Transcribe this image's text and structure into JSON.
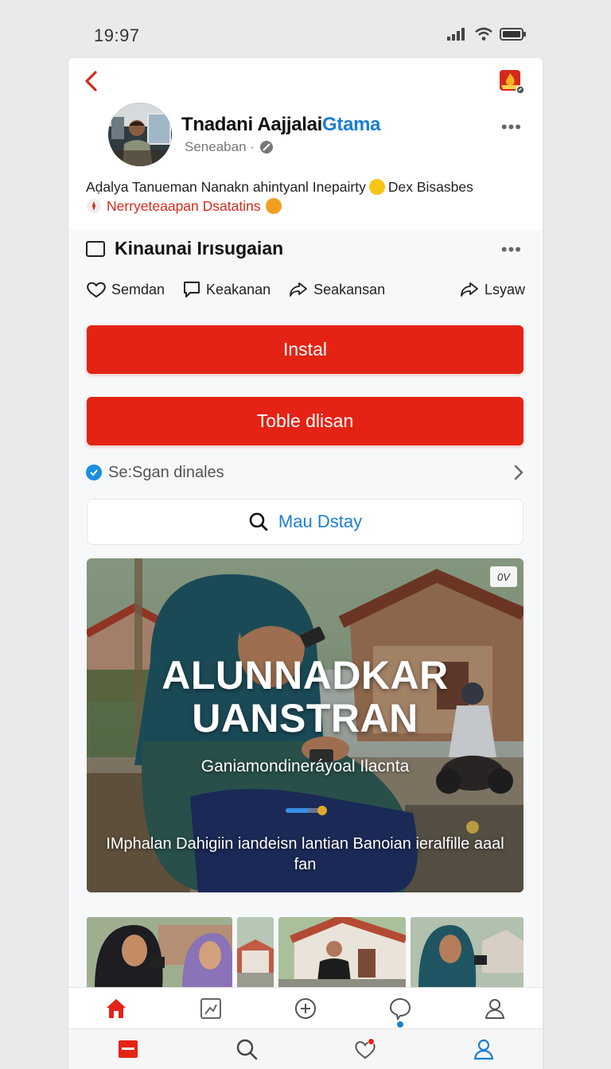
{
  "status": {
    "time": "19:97"
  },
  "profile": {
    "name_part1": "Tnadani Aajjalai",
    "name_part2": "Gtama",
    "subtitle": "Seneaban ·"
  },
  "post": {
    "line1": "Aḍalya Tanueman Nanakn ahintyanl Inepairty",
    "line1_tail": "Dex Bisasbes",
    "line2": "Nerryeteaapan Dsatatins"
  },
  "section": {
    "title": "Kinaunai Irısugaian",
    "actions": [
      {
        "label": "Semdan",
        "icon": "heart-icon"
      },
      {
        "label": "Keakanan",
        "icon": "comment-icon"
      },
      {
        "label": "Seakansan",
        "icon": "share-icon"
      },
      {
        "label": "Lsyaw",
        "icon": "share-icon"
      }
    ]
  },
  "buttons": {
    "install": "Instal",
    "toble": "Toble dlisan"
  },
  "link_row": {
    "label": "Se:Sgan dinales"
  },
  "search": {
    "label": "Mau Dstay"
  },
  "hero": {
    "tag": "0V",
    "title_line1": "ALUNNADKAR",
    "title_line2": "UANSTRAN",
    "subtitle": "Ganiamondineráyoal Ilacnta",
    "caption": "IMphalan Dahigiin iandeisn lantian Banoian ieralfille aaal fan",
    "progress": 0.6
  },
  "nav_top": [
    "home-icon",
    "image-edit-icon",
    "add-icon",
    "chat-icon",
    "profile-icon"
  ],
  "nav_bottom": [
    "menu-icon",
    "search-icon",
    "heart-icon",
    "profile-icon"
  ],
  "colors": {
    "accent_red": "#e42314",
    "link_blue": "#1a7fd6"
  }
}
